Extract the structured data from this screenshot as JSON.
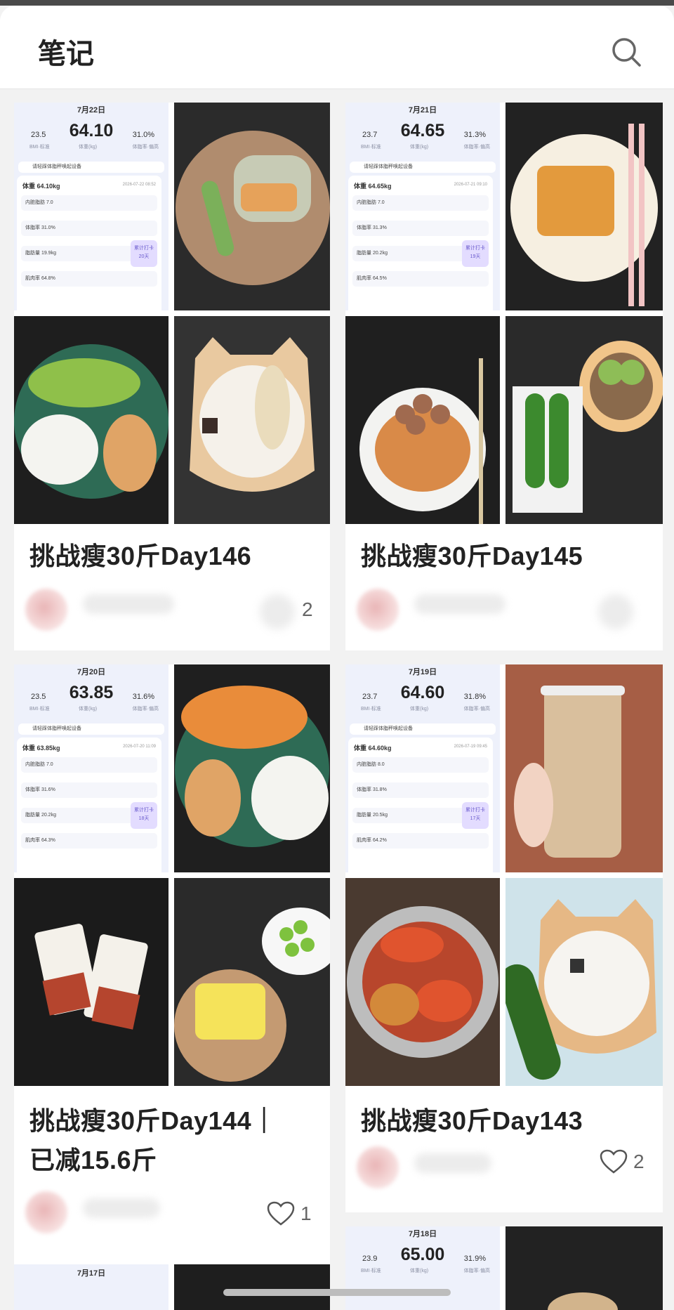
{
  "header": {
    "title": "笔记",
    "search_icon": "search-icon"
  },
  "cards": [
    {
      "title": "挑战瘦30斤Day146",
      "likes": "2",
      "scale": {
        "date": "7月22日",
        "weight": "64.10",
        "bmi": "23.5",
        "fat": "31.0%",
        "weight_row": "体重 64.10kg",
        "time": "2026-07-22 08:52",
        "rows": [
          "内脏脂肪 7.0",
          "体脂率 31.0%",
          "脂肪量 19.9kg",
          "肌肉率 64.8%"
        ],
        "days": "20天"
      }
    },
    {
      "title": "挑战瘦30斤Day145",
      "likes": "",
      "scale": {
        "date": "7月21日",
        "weight": "64.65",
        "bmi": "23.7",
        "fat": "31.3%",
        "weight_row": "体重 64.65kg",
        "time": "2026-07-21 09:10",
        "rows": [
          "内脏脂肪 7.0",
          "体脂率 31.3%",
          "脂肪量 20.2kg",
          "肌肉率 64.5%"
        ],
        "days": "19天"
      }
    },
    {
      "title": "挑战瘦30斤Day144｜已减15.6斤",
      "title_line1": "挑战瘦30斤Day144｜",
      "title_line2": "已减15.6斤",
      "likes": "1",
      "scale": {
        "date": "7月20日",
        "weight": "63.85",
        "bmi": "23.5",
        "fat": "31.6%",
        "weight_row": "体重 63.85kg",
        "time": "2026-07-20 11:09",
        "rows": [
          "内脏脂肪 7.0",
          "体脂率 31.6%",
          "脂肪量 20.2kg",
          "肌肉率 64.3%"
        ],
        "days": "18天"
      }
    },
    {
      "title": "挑战瘦30斤Day143",
      "likes": "2",
      "scale": {
        "date": "7月19日",
        "weight": "64.60",
        "bmi": "23.7",
        "fat": "31.8%",
        "weight_row": "体重 64.60kg",
        "time": "2026-07-19 09:45",
        "rows": [
          "内脏脂肪 8.0",
          "体脂率 31.8%",
          "脂肪量 20.5kg",
          "肌肉率 64.2%"
        ],
        "days": "17天"
      }
    }
  ],
  "partial": {
    "left_date": "7月17日",
    "right": {
      "date": "7月18日",
      "weight": "65.00",
      "bmi": "23.9",
      "fat": "31.9%"
    }
  },
  "scale_labels": {
    "bmi_label": "BMI·标准",
    "weight_label": "体重(kg)",
    "fat_label": "体脂率·偏高",
    "connect": "请轻踩体脂秤唤起设备",
    "checkin": "累计打卡"
  }
}
